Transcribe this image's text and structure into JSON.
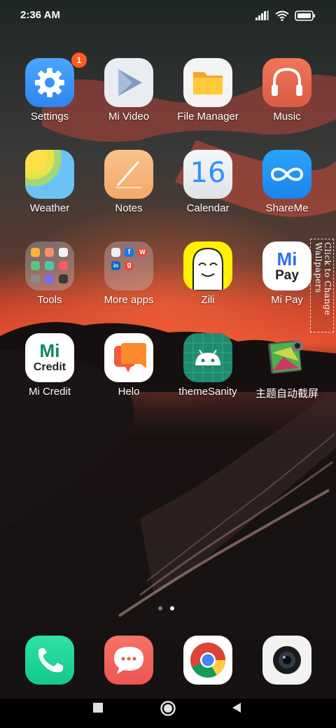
{
  "status_bar": {
    "time": "2:36 AM",
    "icons": [
      "signal-icon",
      "wifi-icon",
      "battery-icon"
    ]
  },
  "apps": [
    {
      "label": "Settings",
      "icon": "settings-gear-icon",
      "badge": "1"
    },
    {
      "label": "Mi Video",
      "icon": "play-icon"
    },
    {
      "label": "File Manager",
      "icon": "folder-icon"
    },
    {
      "label": "Music",
      "icon": "headphones-icon"
    },
    {
      "label": "Weather",
      "icon": "sun-icon"
    },
    {
      "label": "Notes",
      "icon": "pen-icon"
    },
    {
      "label": "Calendar",
      "icon": "calendar-icon",
      "icon_text": "16"
    },
    {
      "label": "ShareMe",
      "icon": "infinity-icon"
    },
    {
      "label": "Tools",
      "icon": "folder-grid-icon"
    },
    {
      "label": "More apps",
      "icon": "folder-grid-icon"
    },
    {
      "label": "Zili",
      "icon": "ghost-face-icon"
    },
    {
      "label": "Mi Pay",
      "icon": "mi-pay-logo",
      "icon_text_top": "Mi",
      "icon_text_bottom": "Pay"
    },
    {
      "label": "Mi Credit",
      "icon": "mi-credit-logo",
      "icon_text_top": "Mi",
      "icon_text_bottom": "Credit"
    },
    {
      "label": "Helo",
      "icon": "chat-bubbles-icon"
    },
    {
      "label": "themeSanity",
      "icon": "android-robot-icon"
    },
    {
      "label": "主题自动截屏",
      "icon": "image-camera-icon"
    }
  ],
  "more_apps_folder_letters": [
    "f",
    "W",
    "in",
    "g"
  ],
  "wallpaper_tag": "Click to Change Wallpapers",
  "page_indicator": {
    "count": 2,
    "active": 2
  },
  "dock": [
    {
      "name": "Phone",
      "icon": "phone-icon"
    },
    {
      "name": "Messages",
      "icon": "message-icon"
    },
    {
      "name": "Chrome",
      "icon": "chrome-icon"
    },
    {
      "name": "Camera",
      "icon": "camera-icon"
    }
  ],
  "nav_bar": [
    "recents-button",
    "home-button",
    "back-button"
  ],
  "colors": {
    "settings_blue": "#2f8ff0",
    "badge_orange": "#ff5a1f",
    "music_orange": "#e4674c",
    "notes_orange": "#f7b47a",
    "shareme_blue": "#1e8ff0",
    "zili_yellow": "#fff200",
    "credit_green": "#0e8a5f",
    "helo_orange": "#fb7a2e",
    "android_green": "#1f8a70",
    "phone_green": "#20d39a",
    "message_red": "#f0605a"
  }
}
